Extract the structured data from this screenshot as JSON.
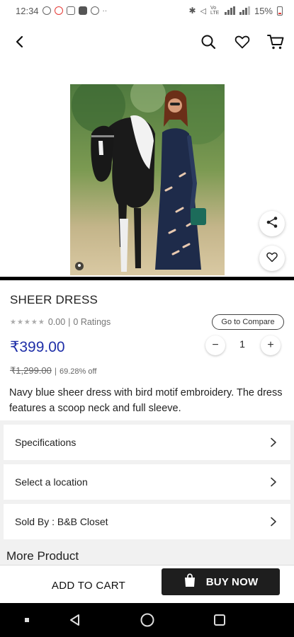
{
  "status_bar": {
    "time": "12:34",
    "battery": "15%",
    "signal_text": "Vo LTE"
  },
  "product": {
    "title": "SHEER DRESS",
    "rating": "0.00",
    "ratings_count": "0 Ratings",
    "compare_label": "Go to Compare",
    "price": "₹399.00",
    "quantity": "1",
    "qty_minus": "−",
    "qty_plus": "+",
    "original_price": "₹1,299.00",
    "separator": "|",
    "discount": "69.28% off",
    "description": "Navy blue sheer dress with bird motif embroidery. The dress features a scoop neck and full sleeve."
  },
  "sections": [
    {
      "label": "Specifications"
    },
    {
      "label": "Select a location"
    },
    {
      "label": "Sold By : B&B Closet"
    }
  ],
  "more_product_label": "More Product",
  "actions": {
    "add_to_cart": "ADD TO CART",
    "buy_now": "BUY NOW"
  },
  "icons": {
    "back": "back-arrow-icon",
    "search": "search-icon",
    "wishlist": "heart-icon",
    "cart": "cart-icon",
    "share": "share-icon",
    "bag": "shopping-bag-icon"
  },
  "colors": {
    "price": "#1f2fa8",
    "buy_now_bg": "#1e1e1e",
    "page_bg": "#f1f1f1"
  }
}
